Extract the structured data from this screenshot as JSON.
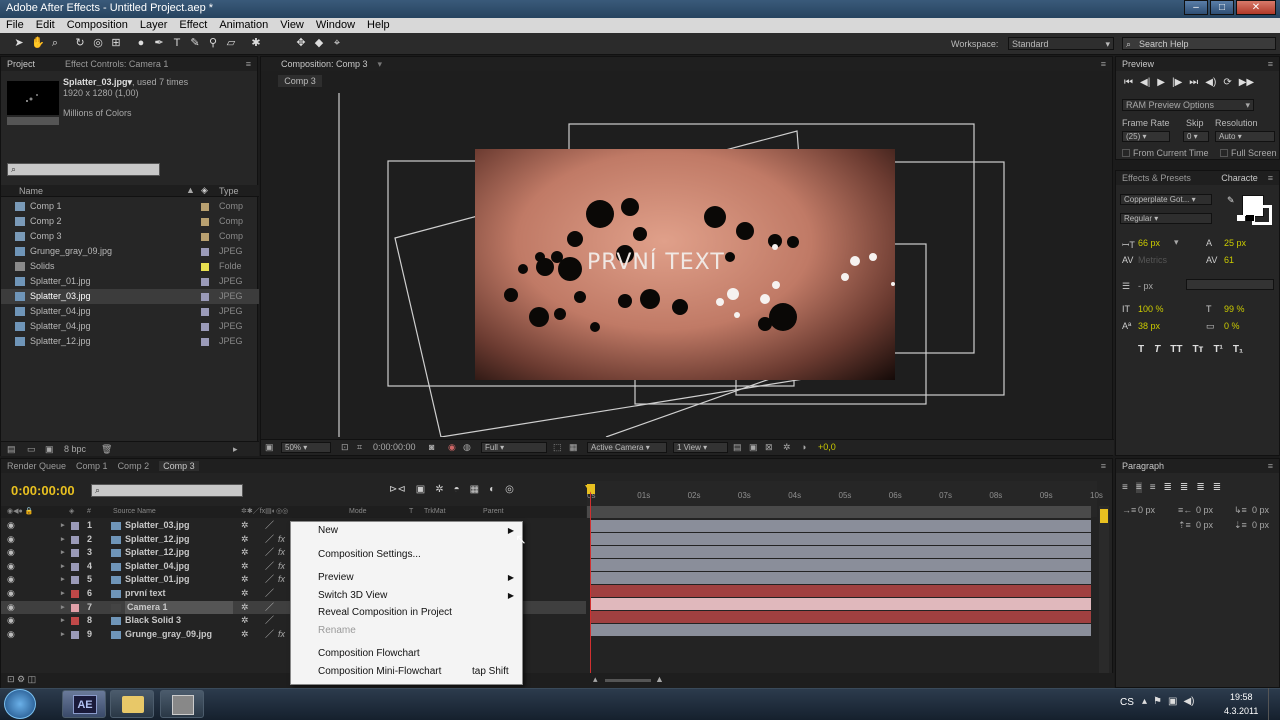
{
  "window": {
    "title": "Adobe After Effects - Untitled Project.aep *"
  },
  "menu": [
    "File",
    "Edit",
    "Composition",
    "Layer",
    "Effect",
    "Animation",
    "View",
    "Window",
    "Help"
  ],
  "toolbar": {
    "workspace_label": "Workspace:",
    "workspace_value": "Standard",
    "search_placeholder": "Search Help"
  },
  "project": {
    "tab": "Project",
    "effect_tab": "Effect Controls: Camera 1",
    "item_name": "Splatter_03.jpg▾",
    "item_used": ", used 7 times",
    "item_size": "1920 x 1280 (1,00)",
    "item_colors": "Millions of Colors",
    "col_name": "Name",
    "col_type": "Type",
    "bpc": "8 bpc",
    "items": [
      {
        "name": "Comp 1",
        "type": "Comp",
        "color": "#b8a070",
        "icon": "comp"
      },
      {
        "name": "Comp 2",
        "type": "Comp",
        "color": "#b8a070",
        "icon": "comp"
      },
      {
        "name": "Comp 3",
        "type": "Comp",
        "color": "#b8a070",
        "icon": "comp"
      },
      {
        "name": "Grunge_gray_09.jpg",
        "type": "JPEG",
        "color": "#9a9ab8",
        "icon": "image"
      },
      {
        "name": "Solids",
        "type": "Folde",
        "color": "#e8e050",
        "icon": "folder"
      },
      {
        "name": "Splatter_01.jpg",
        "type": "JPEG",
        "color": "#9a9ab8",
        "icon": "image"
      },
      {
        "name": "Splatter_03.jpg",
        "type": "JPEG",
        "color": "#9a9ab8",
        "icon": "image",
        "selected": true
      },
      {
        "name": "Splatter_04.jpg",
        "type": "JPEG",
        "color": "#9a9ab8",
        "icon": "image"
      },
      {
        "name": "Splatter_04.jpg",
        "type": "JPEG",
        "color": "#9a9ab8",
        "icon": "image"
      },
      {
        "name": "Splatter_12.jpg",
        "type": "JPEG",
        "color": "#9a9ab8",
        "icon": "image"
      }
    ]
  },
  "comp": {
    "tab": "Composition: Comp 3",
    "crumb": "Comp 3",
    "overlay_text": "PRVNÍ TEXT",
    "zoom": "50%",
    "timecode": "0:00:00:00",
    "resolution": "Full",
    "camera": "Active Camera",
    "views": "1 View",
    "offset": "+0,0"
  },
  "preview": {
    "tab": "Preview",
    "ram": "RAM Preview Options",
    "frame_rate_label": "Frame Rate",
    "skip_label": "Skip",
    "resolution_label": "Resolution",
    "frame_rate": "(25)",
    "skip": "0",
    "resolution": "Auto",
    "from_current": "From Current Time",
    "full_screen": "Full Screen"
  },
  "effects": {
    "tab": "Effects & Presets",
    "char_tab": "Characte",
    "font": "Copperplate Got...",
    "style": "Regular",
    "size": "66 px",
    "leading": "25 px",
    "tracking_auto": "Metrics",
    "tracking": "61",
    "stroke": "- px",
    "vscale": "100 %",
    "hscale": "99 %",
    "baseline": "38 px",
    "tsume": "0 %"
  },
  "paragraph": {
    "tab": "Paragraph",
    "v1": "0 px",
    "v2": "0 px",
    "v3": "0 px",
    "v4": "0 px",
    "v5": "0 px"
  },
  "timeline": {
    "tabs": [
      "Render Queue",
      "Comp 1",
      "Comp 2",
      "Comp 3"
    ],
    "timecode": "0:00:00:00",
    "col_source": "Source Name",
    "col_mode": "Mode",
    "col_trkmat": "TrkMat",
    "col_parent": "Parent",
    "col_num": "#",
    "ruler": [
      "0s",
      "01s",
      "02s",
      "03s",
      "04s",
      "05s",
      "06s",
      "07s",
      "08s",
      "09s",
      "10s"
    ],
    "layers": [
      {
        "num": "1",
        "name": "Splatter_03.jpg",
        "color": "#9a9ab8",
        "bar": "#8a8e9a",
        "fx": false
      },
      {
        "num": "2",
        "name": "Splatter_12.jpg",
        "color": "#9a9ab8",
        "bar": "#8a8e9a",
        "fx": true
      },
      {
        "num": "3",
        "name": "Splatter_12.jpg",
        "color": "#9a9ab8",
        "bar": "#8a8e9a",
        "fx": true
      },
      {
        "num": "4",
        "name": "Splatter_04.jpg",
        "color": "#9a9ab8",
        "bar": "#8a8e9a",
        "fx": true
      },
      {
        "num": "5",
        "name": "Splatter_01.jpg",
        "color": "#9a9ab8",
        "bar": "#8a8e9a",
        "fx": true
      },
      {
        "num": "6",
        "name": "první text",
        "color": "#c04848",
        "bar": "#a04040",
        "fx": false
      },
      {
        "num": "7",
        "name": "Camera 1",
        "color": "#e0a0a8",
        "bar": "#e0b8bc",
        "fx": false,
        "selected": true
      },
      {
        "num": "8",
        "name": "Black Solid 3",
        "color": "#c04848",
        "bar": "#a04040",
        "fx": false
      },
      {
        "num": "9",
        "name": "Grunge_gray_09.jpg",
        "color": "#9a9ab8",
        "bar": "#8a8e9a",
        "fx": true
      }
    ]
  },
  "context_menu": [
    {
      "label": "New",
      "arrow": true
    },
    {
      "sep": true
    },
    {
      "label": "Composition Settings..."
    },
    {
      "sep": true
    },
    {
      "label": "Preview",
      "arrow": true
    },
    {
      "label": "Switch 3D View",
      "arrow": true
    },
    {
      "label": "Reveal Composition in Project"
    },
    {
      "label": "Rename",
      "disabled": true
    },
    {
      "sep": true
    },
    {
      "label": "Composition Flowchart"
    },
    {
      "label": "Composition Mini-Flowchart",
      "shortcut": "tap Shift"
    }
  ],
  "taskbar": {
    "lang": "CS",
    "time": "19:58",
    "date": "4.3.2011",
    "ae_label": "AE"
  }
}
